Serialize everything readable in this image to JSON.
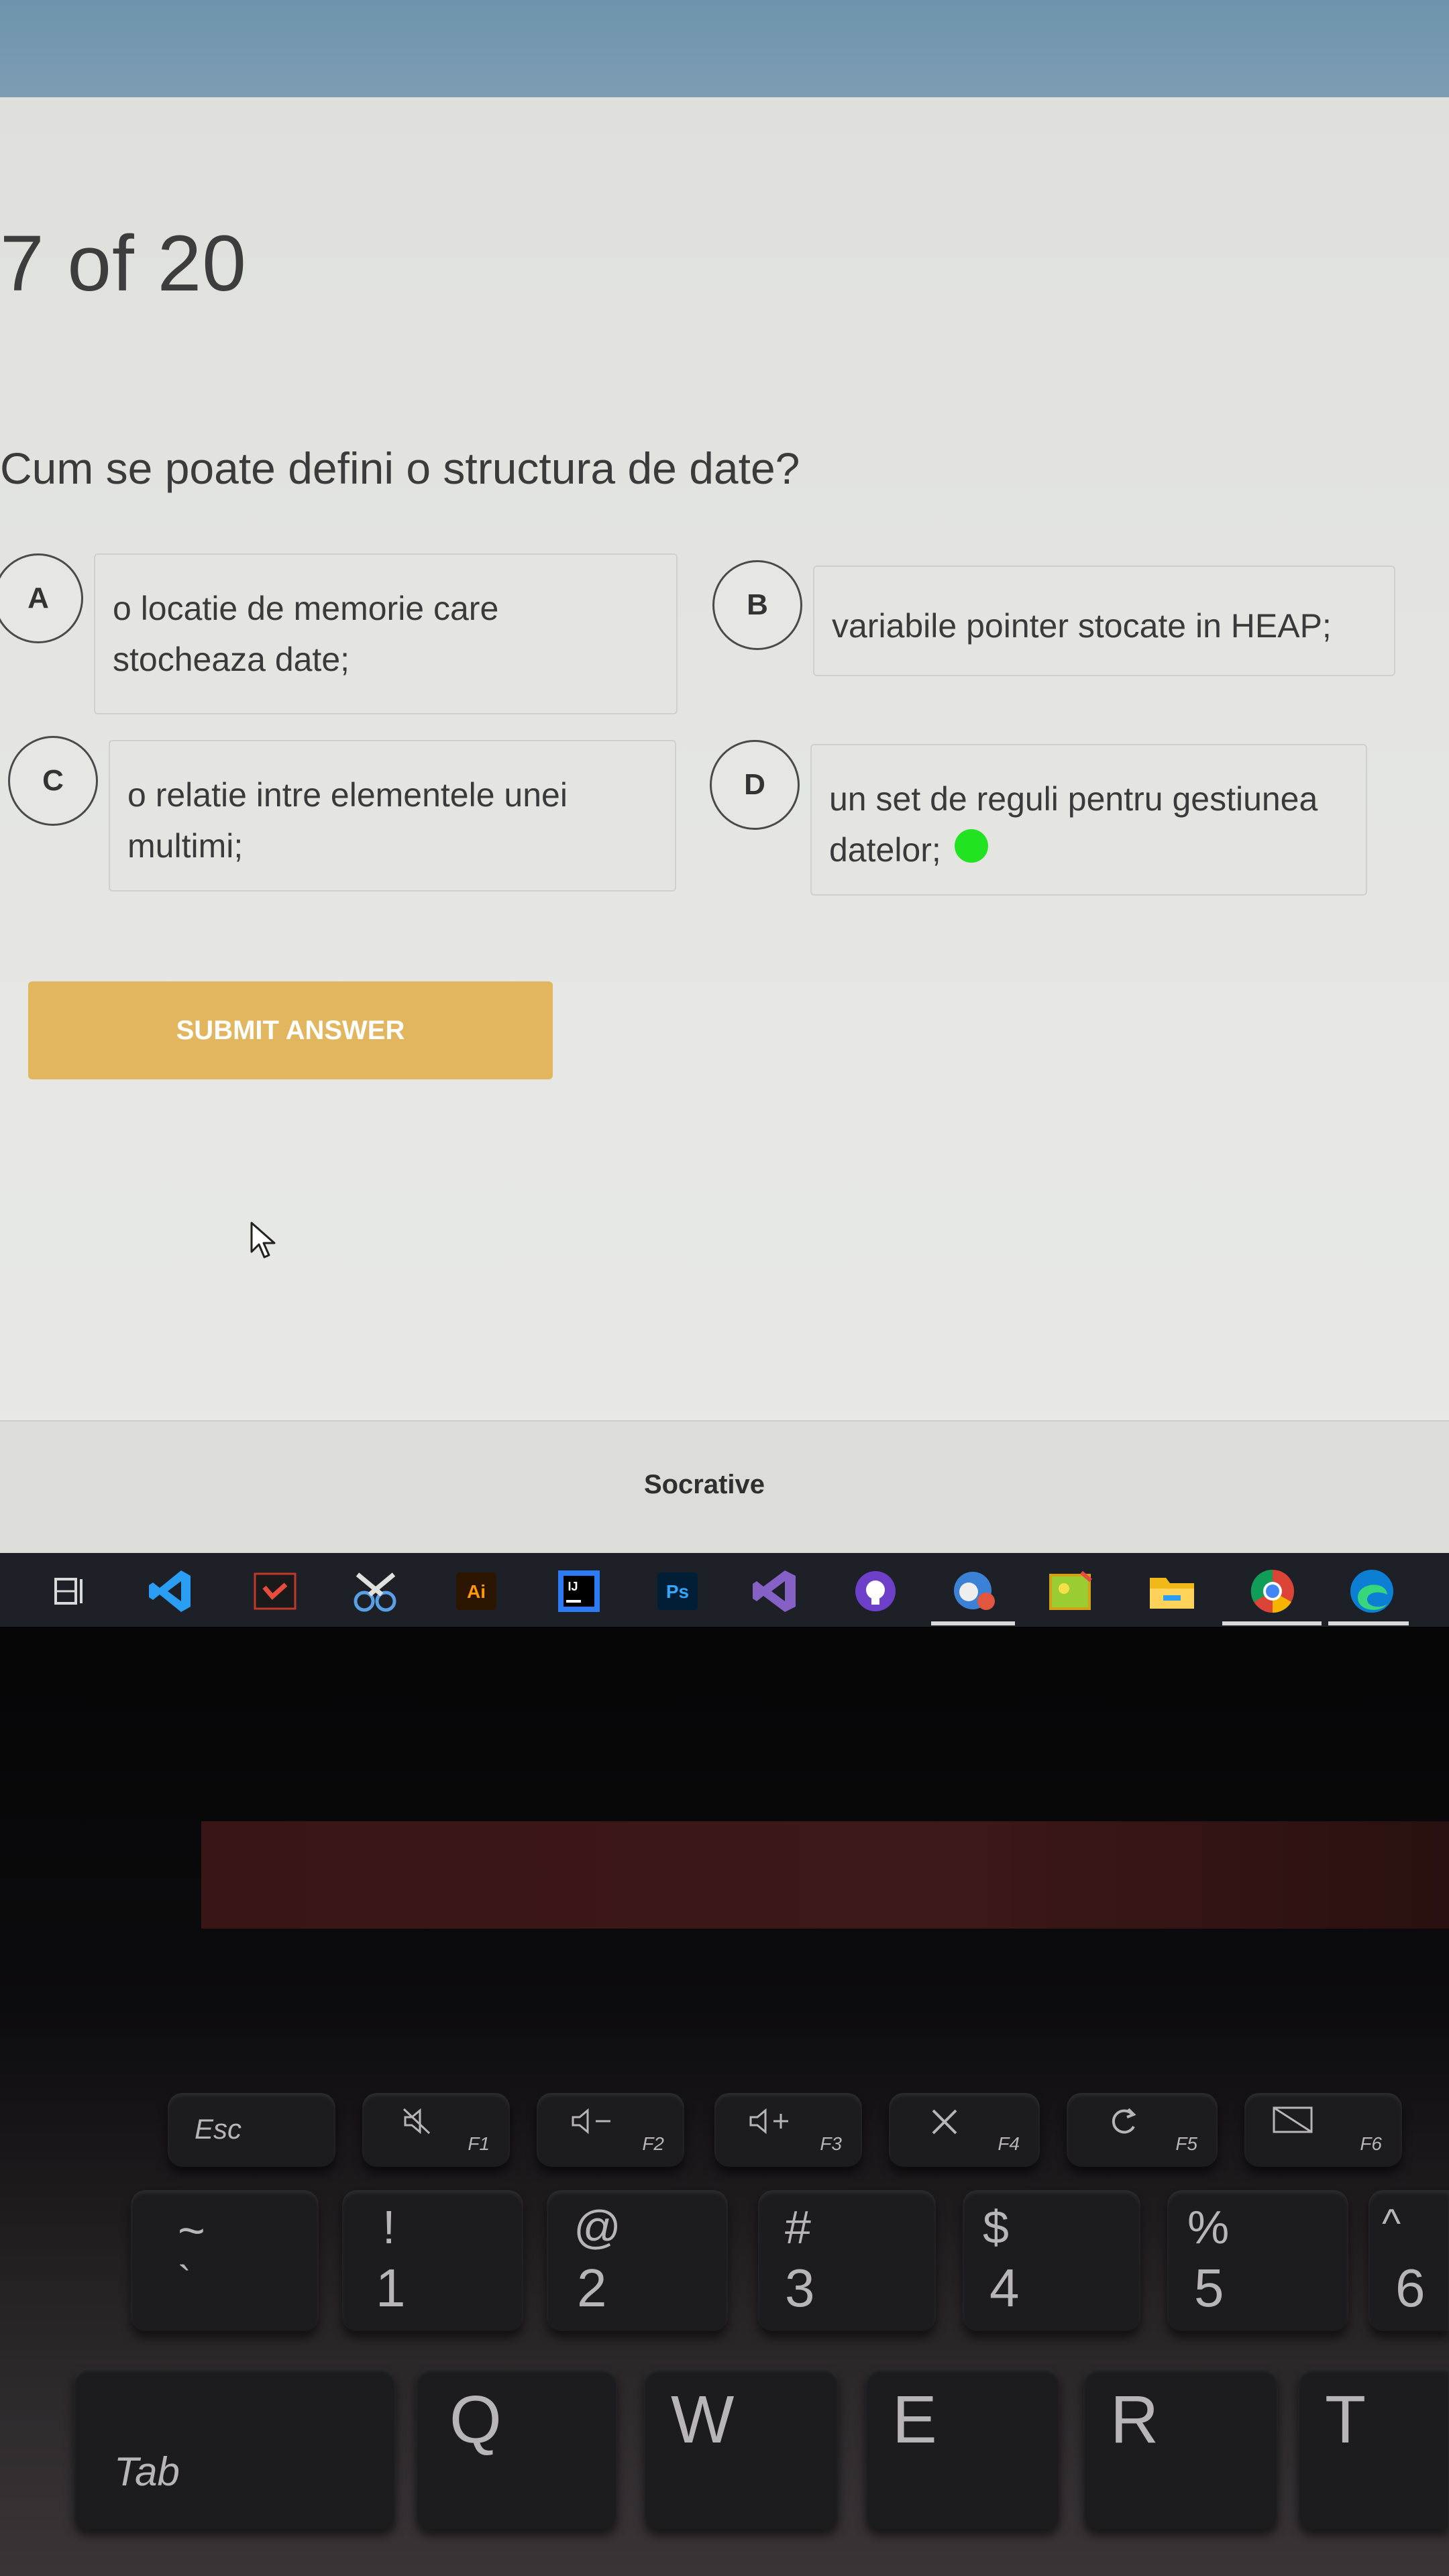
{
  "quiz": {
    "progress": "7 of 20",
    "question": "Cum se poate defini o structura de date?",
    "options": [
      {
        "letter": "A",
        "text": "o locatie de memorie care stocheaza date;"
      },
      {
        "letter": "B",
        "text": "variabile pointer stocate in HEAP;"
      },
      {
        "letter": "C",
        "text": "o relatie intre elementele unei multimi;"
      },
      {
        "letter": "D",
        "text": "un set de reguli pentru gestiunea datelor;"
      }
    ],
    "submit_label": "SUBMIT ANSWER",
    "footer": "Socrative"
  },
  "taskbar": {
    "icons": [
      "task-view-icon",
      "vscode-icon",
      "pdf-reader-icon",
      "snipping-tool-icon",
      "illustrator-icon",
      "intellij-icon",
      "photoshop-icon",
      "visual-studio-icon",
      "github-desktop-icon",
      "game-app-icon",
      "image-app-icon",
      "file-explorer-icon",
      "chrome-icon",
      "edge-icon"
    ],
    "labels": {
      "illustrator": "Ai",
      "intellij": "IJ",
      "photoshop": "Ps"
    }
  },
  "keyboard": {
    "fn_row": [
      {
        "main": "Esc",
        "sub": ""
      },
      {
        "main": "",
        "sub": "F1"
      },
      {
        "main": "",
        "sub": "F2"
      },
      {
        "main": "",
        "sub": "F3"
      },
      {
        "main": "",
        "sub": "F4"
      },
      {
        "main": "",
        "sub": "F5"
      },
      {
        "main": "",
        "sub": "F6"
      }
    ],
    "number_row": [
      {
        "top": "~",
        "bottom": "`"
      },
      {
        "top": "!",
        "bottom": "1"
      },
      {
        "top": "@",
        "bottom": "2"
      },
      {
        "top": "#",
        "bottom": "3"
      },
      {
        "top": "$",
        "bottom": "4"
      },
      {
        "top": "%",
        "bottom": "5"
      },
      {
        "top": "^",
        "bottom": "6"
      }
    ],
    "letter_row": [
      "Tab",
      "Q",
      "W",
      "E",
      "R",
      "T"
    ]
  },
  "colors": {
    "submit": "#e2b55f",
    "screen_bg": "#e4e5e1",
    "selected_dot": "#22e322",
    "taskbar": "#1d2027"
  }
}
